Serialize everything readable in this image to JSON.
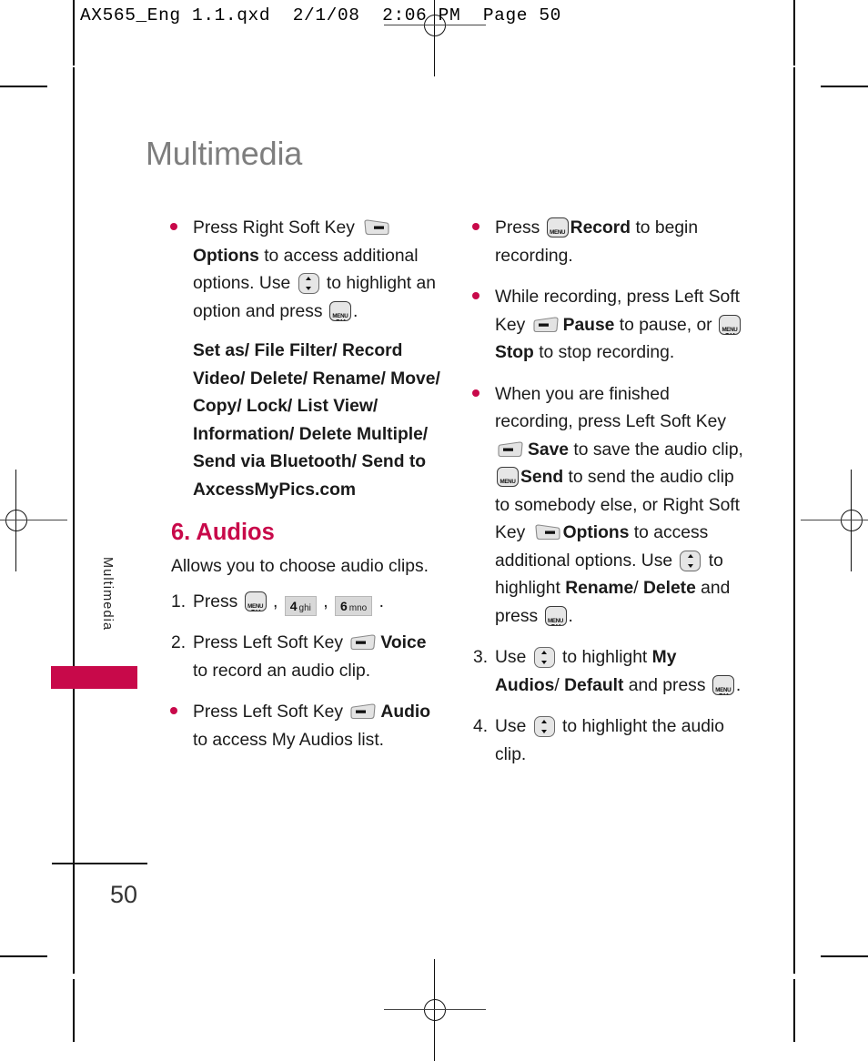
{
  "doc": {
    "header_line": "AX565_Eng 1.1.qxd  2/1/08  2:06 PM  Page 50",
    "page_title": "Multimedia",
    "side_tab_label": "Multimedia",
    "page_number": "50",
    "accent_color": "#c8094a",
    "title_color": "#7e7e7e"
  },
  "icons": {
    "menu_ok_top": "MENU",
    "menu_ok_bottom": "OK",
    "left_soft_key": "left-soft-key-icon",
    "right_soft_key": "right-soft-key-icon",
    "nav_updown": "up-down-nav-key-icon",
    "key4_digit": "4",
    "key4_letters": "ghi",
    "key6_digit": "6",
    "key6_letters": "mno"
  },
  "left_column": {
    "bullet_options": {
      "t1": "Press Right Soft Key ",
      "b1": "Options",
      "t2": " to access additional options. Use ",
      "t3": " to highlight an option and press ",
      "t4": "."
    },
    "options_list": "Set as/ File Filter/ Record Video/ Delete/ Rename/ Move/ Copy/ Lock/ List View/ Information/ Delete Multiple/ Send via Bluetooth/ Send to AxcessMyPics.com",
    "section_heading": "6. Audios",
    "section_desc": "Allows you to choose audio clips.",
    "step1": {
      "marker": "1.",
      "t1": "Press ",
      "t2": " , ",
      "t3": " , ",
      "t4": " ."
    },
    "step2": {
      "marker": "2.",
      "t1": "Press Left Soft Key ",
      "b1": "Voice",
      "t2": " to record an audio clip."
    },
    "bullet_audio": {
      "t1": "Press Left Soft Key ",
      "b1": "Audio",
      "t2": " to access My Audios list."
    }
  },
  "right_column": {
    "bullet_record": {
      "t1": "Press ",
      "b1": "Record",
      "t2": " to begin recording."
    },
    "bullet_pause": {
      "t1": "While recording, press Left Soft Key ",
      "b1": "Pause",
      "t2": " to pause, or ",
      "b2": "Stop",
      "t3": " to stop recording."
    },
    "bullet_finished": {
      "t1": "When you are finished recording, press Left Soft Key ",
      "b1": "Save",
      "t2": " to save the audio clip, ",
      "b2": "Send",
      "t3": " to send the audio clip to somebody else, or Right Soft Key ",
      "b3": "Options",
      "t4": " to access additional options. Use ",
      "t5": " to highlight ",
      "b4": "Rename",
      "t6": "/ ",
      "b5": "Delete",
      "t7": " and press ",
      "t8": "."
    },
    "step3": {
      "marker": "3.",
      "t1": "Use ",
      "t2": " to highlight ",
      "b1": "My Audios",
      "t3": "/ ",
      "b2": "Default",
      "t4": " and press ",
      "t5": "."
    },
    "step4": {
      "marker": "4.",
      "t1": "Use ",
      "t2": " to highlight the audio clip."
    }
  }
}
